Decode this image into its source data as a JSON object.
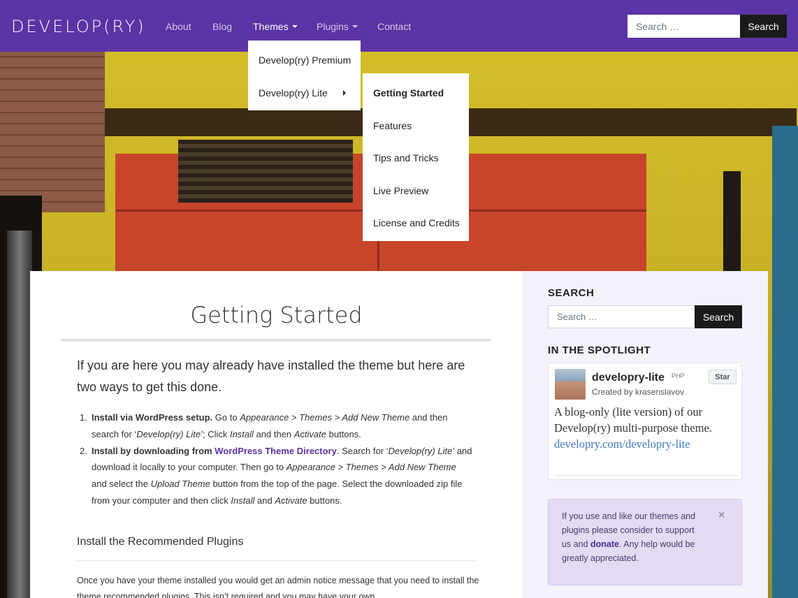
{
  "navbar": {
    "brand": "DEVELOP(RY)",
    "items": [
      {
        "label": "About"
      },
      {
        "label": "Blog"
      },
      {
        "label": "Themes"
      },
      {
        "label": "Plugins"
      },
      {
        "label": "Contact"
      }
    ],
    "search_placeholder": "Search …",
    "search_button": "Search"
  },
  "themes_menu": {
    "items": [
      {
        "label": "Develop(ry) Premium"
      },
      {
        "label": "Develop(ry) Lite"
      }
    ]
  },
  "lite_submenu": {
    "items": [
      {
        "label": "Getting Started"
      },
      {
        "label": "Features"
      },
      {
        "label": "Tips and Tricks"
      },
      {
        "label": "Live Preview"
      },
      {
        "label": "License and Credits"
      }
    ]
  },
  "main": {
    "title": "Getting Started",
    "lead": "If you are here you may already have installed the theme but here are two ways to get this done.",
    "steps": [
      {
        "num": "1.",
        "bold": "Install via WordPress setup.",
        "t1": " Go to ",
        "i1": "Appearance > Themes > Add New Theme",
        "t2": " and then search for ‘",
        "i2": "Develop(ry) Lite’",
        "t3": "; Click ",
        "i3": "Install",
        "t4": " and then ",
        "i4": "Activate",
        "t5": " buttons."
      },
      {
        "num": "2.",
        "bold": "Install by downloading from ",
        "link": "WordPress Theme Directory",
        "t1": ". Search for ‘",
        "i1": "Develop(ry) Lite’",
        "t2": " and download it locally to your computer. Then go to ",
        "i2": "Appearance > Themes > Add New Theme",
        "t3": " and select the ",
        "i3": "Upload Theme",
        "t4": " button from the top of the page. Select the downloaded zip file from your computer and then click ",
        "i4": "Install",
        "t5": " and ",
        "i5": "Activate",
        "t6": " buttons."
      }
    ],
    "subheading": "Install the Recommended Plugins",
    "paragraph": "Once you have your theme installed you would get an admin notice message that you need to install the theme recommended plugins. This isn’t required and you may have your own"
  },
  "sidebar": {
    "search_title": "SEARCH",
    "search_placeholder": "Search …",
    "search_button": "Search",
    "spotlight_title": "IN THE SPOTLIGHT",
    "repo": {
      "name": "developry-lite",
      "language": "PHP",
      "star": "Star",
      "created_by": "Created by krasenslavov",
      "description": "A blog-only (lite version) of our Develop(ry) multi-purpose theme. ",
      "link": "developry.com/developry-lite"
    },
    "notice": {
      "text1": "If you use and like our themes and plugins please consider to support us and ",
      "link": "donate",
      "text2": ". Any help would be greatly appreciated.",
      "close": "×"
    }
  },
  "colors": {
    "navbar": "#5a33a4",
    "link": "#5a33a4",
    "button_dark": "#1a1a1a",
    "sidebar_bg": "#f4f3fb",
    "notice_bg": "#e4dcf4"
  }
}
